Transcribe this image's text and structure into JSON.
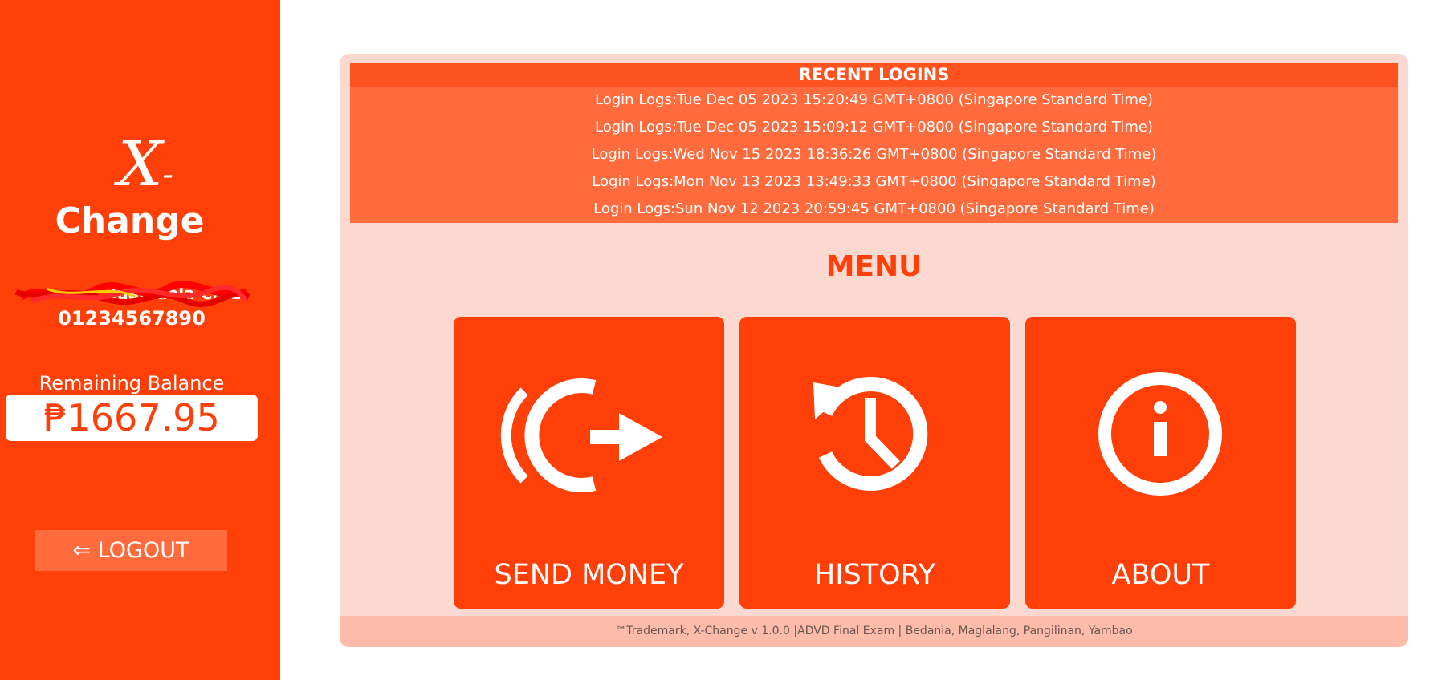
{
  "sidebar": {
    "logo_x": "X",
    "logo_dash": "-",
    "logo_word": "Change",
    "user_name": "Juan dela Cruz",
    "user_number": "01234567890",
    "balance_label": "Remaining Balance",
    "balance_value": "₱1667.95",
    "logout_label": "⇐ LOGOUT"
  },
  "recent_logins": {
    "title": "RECENT LOGINS",
    "entries": [
      "Login Logs:Tue Dec 05 2023 15:20:49 GMT+0800 (Singapore Standard Time)",
      "Login Logs:Tue Dec 05 2023 15:09:12 GMT+0800 (Singapore Standard Time)",
      "Login Logs:Wed Nov 15 2023 18:36:26 GMT+0800 (Singapore Standard Time)",
      "Login Logs:Mon Nov 13 2023 13:49:33 GMT+0800 (Singapore Standard Time)",
      "Login Logs:Sun Nov 12 2023 20:59:45 GMT+0800 (Singapore Standard Time)"
    ]
  },
  "menu": {
    "title": "MENU",
    "items": [
      {
        "label": "SEND MONEY",
        "icon": "send-money-icon"
      },
      {
        "label": "HISTORY",
        "icon": "history-icon"
      },
      {
        "label": "ABOUT",
        "icon": "info-icon"
      }
    ]
  },
  "footer": {
    "text": "™Trademark, X-Change v 1.0.0 |ADVD Final Exam | Bedania, Maglalang, Pangilinan, Yambao"
  },
  "colors": {
    "brand": "#ff3f08",
    "logins_bg": "#ff6b3d",
    "panel_bg": "#fbd8d0",
    "footer_bg": "#fdbcaa"
  }
}
